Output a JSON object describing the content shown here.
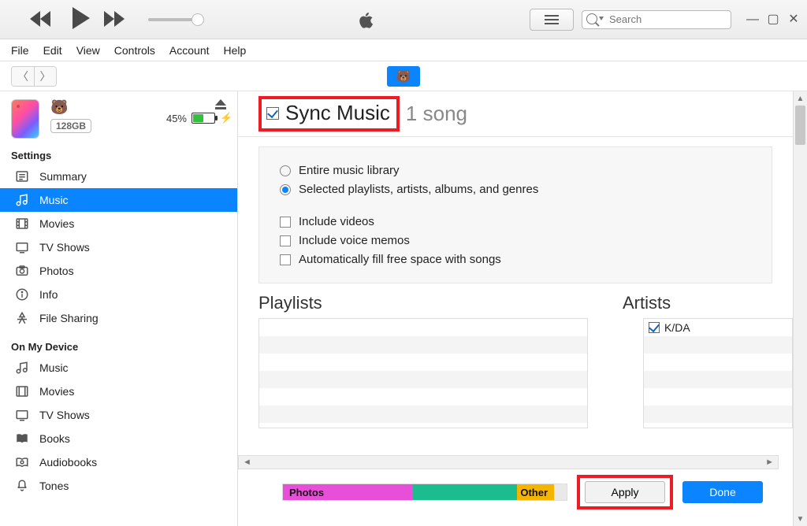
{
  "search": {
    "placeholder": "Search"
  },
  "menubar": [
    "File",
    "Edit",
    "View",
    "Controls",
    "Account",
    "Help"
  ],
  "device": {
    "capacity": "128GB",
    "battery_pct": "45%"
  },
  "sidebar": {
    "section_settings": "Settings",
    "section_on_device": "On My Device",
    "settings": [
      {
        "label": "Summary",
        "icon": "summary"
      },
      {
        "label": "Music",
        "icon": "music"
      },
      {
        "label": "Movies",
        "icon": "movies"
      },
      {
        "label": "TV Shows",
        "icon": "tv"
      },
      {
        "label": "Photos",
        "icon": "photos"
      },
      {
        "label": "Info",
        "icon": "info"
      },
      {
        "label": "File Sharing",
        "icon": "apps"
      }
    ],
    "on_device": [
      {
        "label": "Music",
        "icon": "music-note"
      },
      {
        "label": "Movies",
        "icon": "movies"
      },
      {
        "label": "TV Shows",
        "icon": "tv-screen"
      },
      {
        "label": "Books",
        "icon": "books"
      },
      {
        "label": "Audiobooks",
        "icon": "audiobooks"
      },
      {
        "label": "Tones",
        "icon": "tones"
      }
    ]
  },
  "sync": {
    "title": "Sync Music",
    "count": "1 song",
    "opt_entire": "Entire music library",
    "opt_selected": "Selected playlists, artists, albums, and genres",
    "chk_videos": "Include videos",
    "chk_memos": "Include voice memos",
    "chk_autofill": "Automatically fill free space with songs"
  },
  "columns": {
    "playlists": "Playlists",
    "artists": "Artists"
  },
  "artists": [
    {
      "name": "K/DA",
      "checked": true
    }
  ],
  "storage": {
    "photos": "Photos",
    "other": "Other"
  },
  "buttons": {
    "apply": "Apply",
    "done": "Done"
  }
}
